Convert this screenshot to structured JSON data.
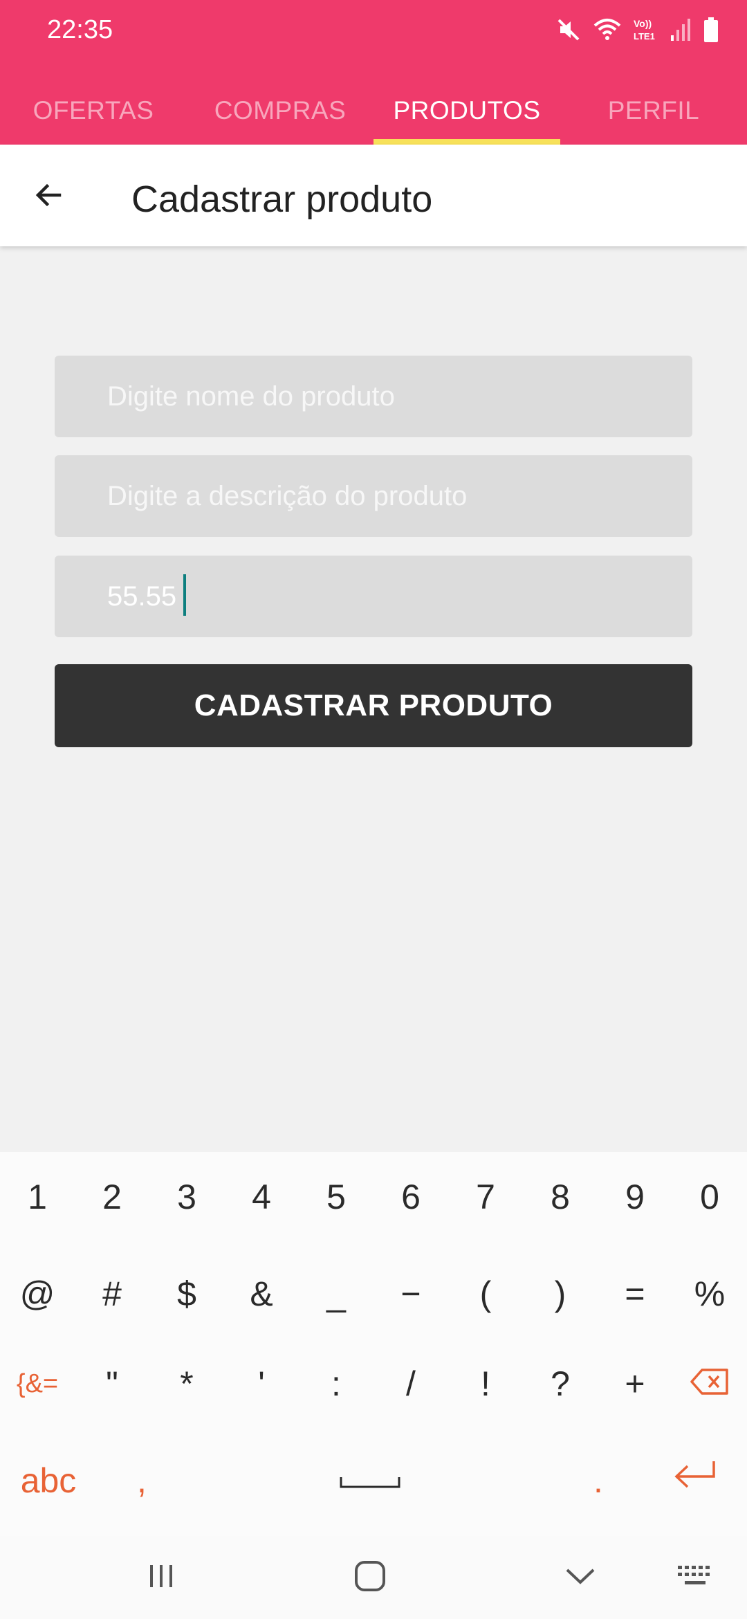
{
  "status_bar": {
    "time": "22:35",
    "icons": [
      "mute-icon",
      "wifi-icon",
      "volte-lte-icon",
      "signal-icon",
      "battery-icon"
    ]
  },
  "tabs": [
    {
      "label": "OFERTAS",
      "active": false
    },
    {
      "label": "COMPRAS",
      "active": false
    },
    {
      "label": "PRODUTOS",
      "active": true
    },
    {
      "label": "PERFIL",
      "active": false
    }
  ],
  "app_bar": {
    "title": "Cadastrar produto",
    "back_icon": "arrow-back-icon"
  },
  "form": {
    "name_placeholder": "Digite nome do produto",
    "name_value": "",
    "description_placeholder": "Digite a descrição do produto",
    "description_value": "",
    "price_value": "55.55",
    "submit_label": "CADASTRAR PRODUTO"
  },
  "keyboard": {
    "row1": [
      "1",
      "2",
      "3",
      "4",
      "5",
      "6",
      "7",
      "8",
      "9",
      "0"
    ],
    "row2": [
      "@",
      "#",
      "$",
      "&",
      "_",
      "−",
      "(",
      ")",
      "=",
      "%"
    ],
    "row3": [
      "{&=",
      "\"",
      "*",
      "'",
      ":",
      "/",
      "!",
      "?",
      "+"
    ],
    "row4": {
      "abc": "abc",
      "comma": ",",
      "period": "."
    }
  },
  "colors": {
    "header": "#ef3a6b",
    "tab_indicator": "#f7e15a",
    "button": "#333333",
    "keyboard_accent": "#e86235"
  }
}
